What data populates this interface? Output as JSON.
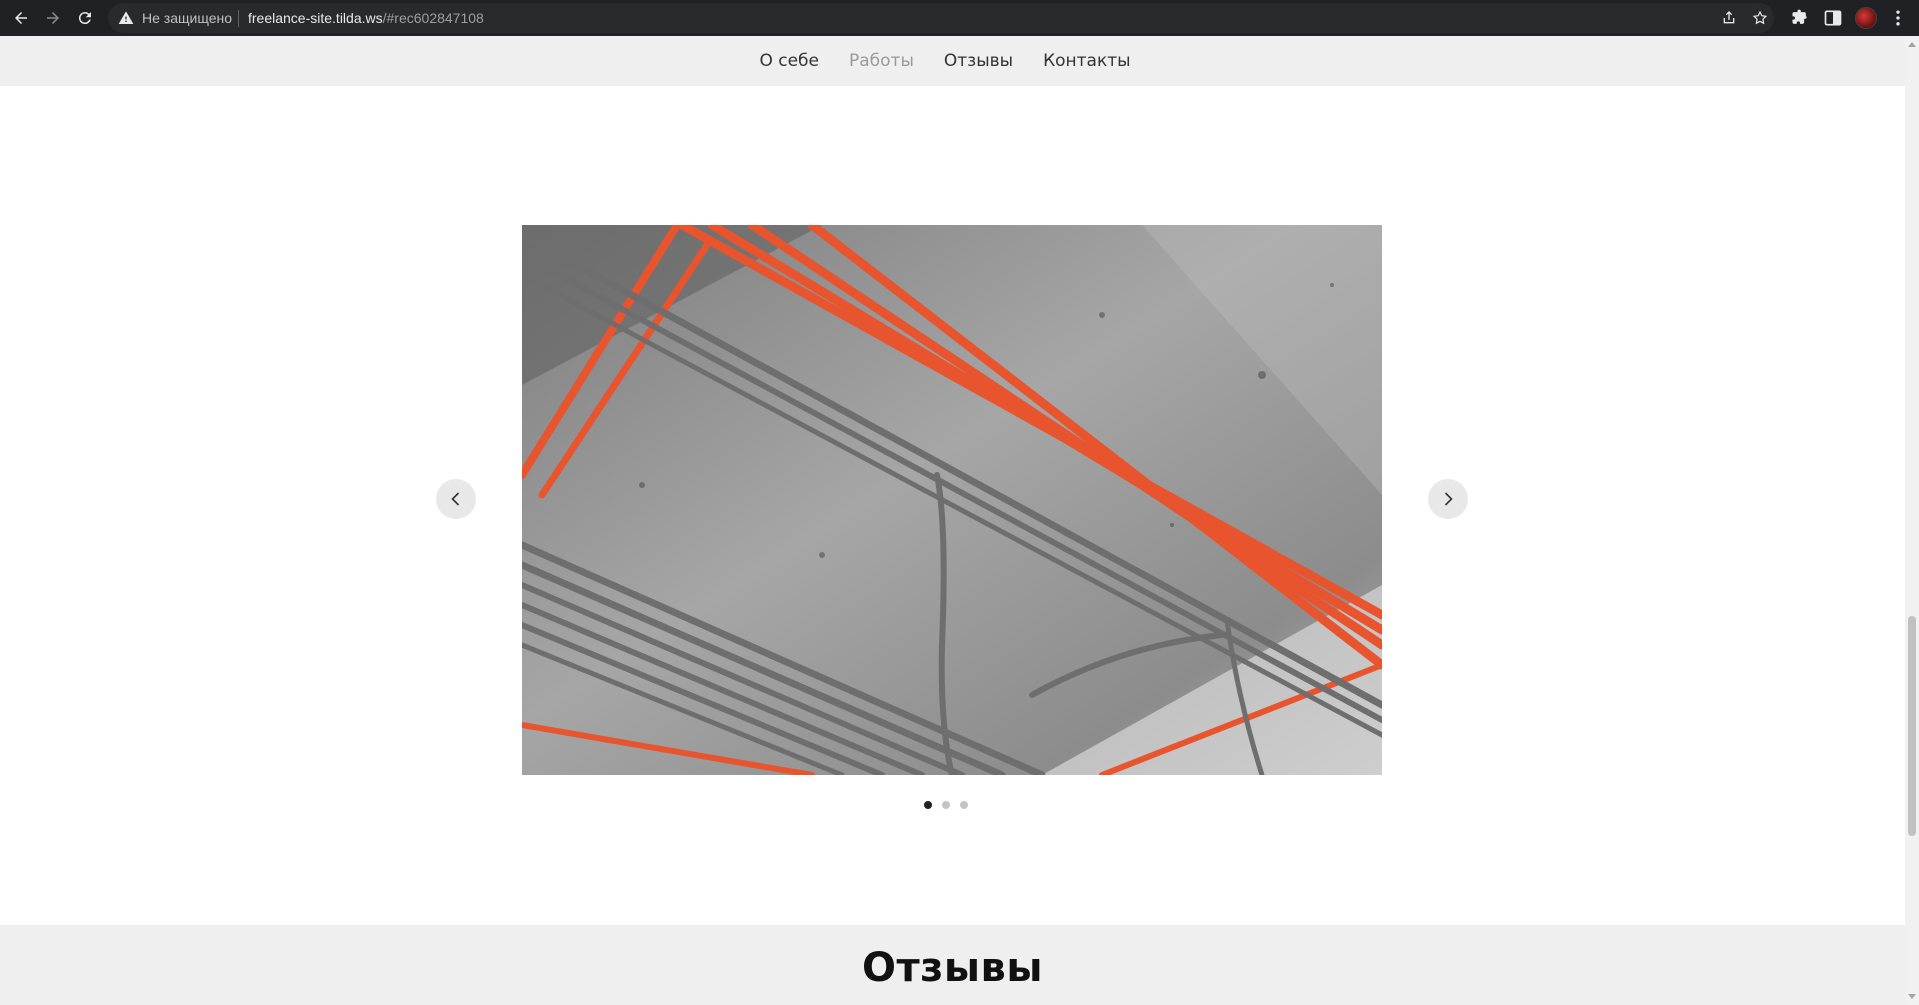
{
  "browser": {
    "security_label": "Не защищено",
    "url_host": "freelance-site.tilda.ws",
    "url_path": "/#rec602847108"
  },
  "nav": {
    "items": [
      {
        "label": "О себе",
        "muted": false
      },
      {
        "label": "Работы",
        "muted": true
      },
      {
        "label": "Отзывы",
        "muted": false
      },
      {
        "label": "Контакты",
        "muted": false
      }
    ]
  },
  "slider": {
    "image_subject": "ceiling-electrical-conduits-photo",
    "slides_total": 3,
    "active_slide": 1,
    "colors": {
      "accent_pipe": "#e8542e",
      "concrete": "#9a9a9a"
    }
  },
  "reviews": {
    "title": "Отзывы"
  }
}
